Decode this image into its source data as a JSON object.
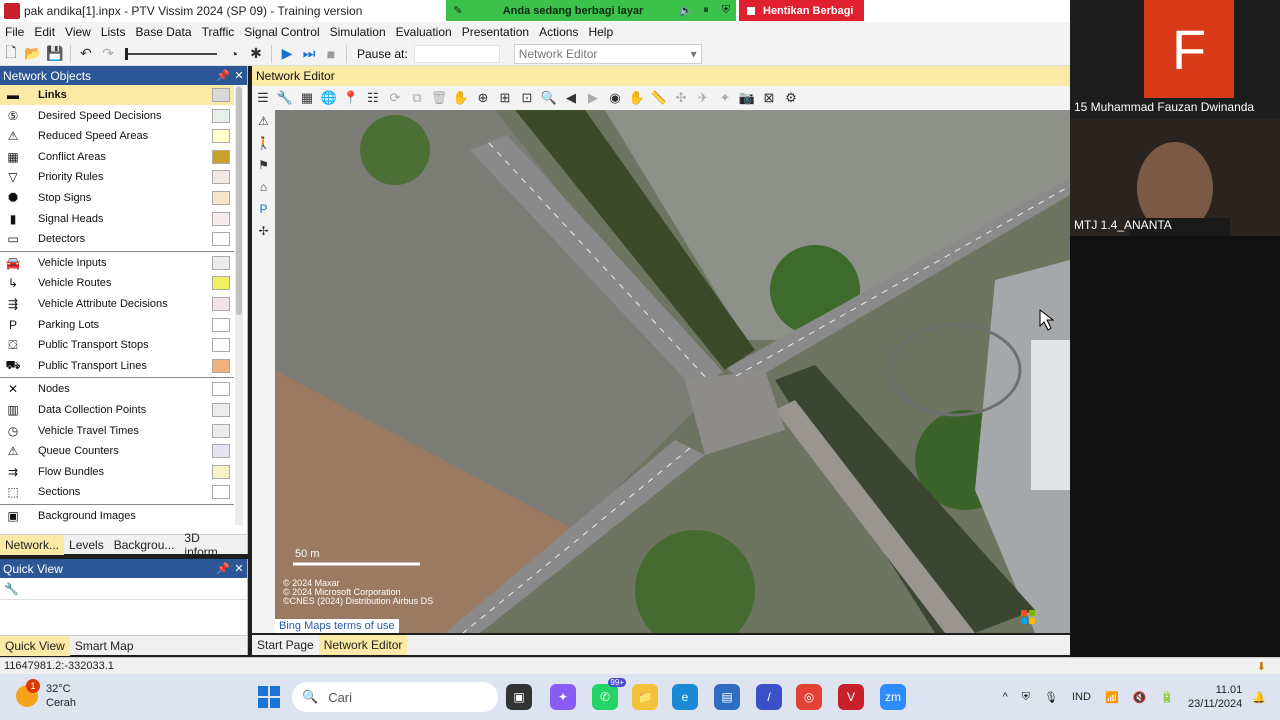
{
  "window": {
    "title": "pak andika[1].inpx - PTV Vissim 2024 (SP 09) - Training version"
  },
  "share_bar": {
    "message": "Anda sedang berbagi layar",
    "stop_label": "Hentikan Berbagi"
  },
  "menu": [
    "File",
    "Edit",
    "View",
    "Lists",
    "Base Data",
    "Traffic",
    "Signal Control",
    "Simulation",
    "Evaluation",
    "Presentation",
    "Actions",
    "Help"
  ],
  "toolbar": {
    "pause_label": "Pause at:",
    "pause_value": "",
    "view_select": "Network Editor"
  },
  "network_objects": {
    "title": "Network Objects",
    "items": [
      {
        "label": "Links",
        "icon": "links-icon",
        "swatch": "#d9d9d9",
        "selected": true
      },
      {
        "label": "Desired Speed Decisions",
        "icon": "speed-sign-icon",
        "swatch": "#e8efe8"
      },
      {
        "label": "Reduced Speed Areas",
        "icon": "warning-triangle-icon",
        "swatch": "#ffffcc"
      },
      {
        "label": "Conflict Areas",
        "icon": "conflict-icon",
        "swatch": "#c8a02a"
      },
      {
        "label": "Priority Rules",
        "icon": "yield-icon",
        "swatch": "#f2e9e4"
      },
      {
        "label": "Stop Signs",
        "icon": "stop-sign-icon",
        "swatch": "#f7e6cc"
      },
      {
        "label": "Signal Heads",
        "icon": "signal-head-icon",
        "swatch": "#f7ecec"
      },
      {
        "label": "Detectors",
        "icon": "detector-icon",
        "swatch": "#ffffff"
      },
      {
        "label": "Vehicle Inputs",
        "icon": "vehicle-input-icon",
        "swatch": "#ececec"
      },
      {
        "label": "Vehicle Routes",
        "icon": "vehicle-route-icon",
        "swatch": "#f0f060"
      },
      {
        "label": "Vehicle Attribute Decisions",
        "icon": "attribute-decision-icon",
        "swatch": "#f2e4e4"
      },
      {
        "label": "Parking Lots",
        "icon": "parking-icon",
        "swatch": "#ffffff"
      },
      {
        "label": "Public Transport Stops",
        "icon": "pt-stop-icon",
        "swatch": "#ffffff"
      },
      {
        "label": "Public Transport Lines",
        "icon": "pt-line-icon",
        "swatch": "#f0b27a"
      },
      {
        "label": "Nodes",
        "icon": "node-icon",
        "swatch": "#ffffff"
      },
      {
        "label": "Data Collection Points",
        "icon": "data-collection-icon",
        "swatch": "#ececec"
      },
      {
        "label": "Vehicle Travel Times",
        "icon": "travel-time-icon",
        "swatch": "#ececec"
      },
      {
        "label": "Queue Counters",
        "icon": "queue-counter-icon",
        "swatch": "#e4e4f2"
      },
      {
        "label": "Flow Bundles",
        "icon": "flow-bundle-icon",
        "swatch": "#f7f2cc"
      },
      {
        "label": "Sections",
        "icon": "section-icon",
        "swatch": "#ffffff"
      },
      {
        "label": "Background Images",
        "icon": "background-image-icon",
        "swatch": ""
      }
    ],
    "tabs": [
      "Network...",
      "Levels",
      "Backgrou...",
      "3D inform..."
    ]
  },
  "quick_view": {
    "title": "Quick View",
    "tabs": [
      "Quick View",
      "Smart Map"
    ]
  },
  "editor": {
    "title": "Network Editor",
    "tabs": [
      "Start Page",
      "Network Editor"
    ],
    "scale_label": "50 m",
    "credits": [
      "© 2024 Maxar",
      "© 2024 Microsoft Corporation",
      "©CNES (2024) Distribution Airbus DS"
    ],
    "terms": "Bing Maps terms of use"
  },
  "status": {
    "coords": "11647981.2:-332033.1"
  },
  "participants": [
    {
      "initial": "F",
      "name": "15 Muhammad Fauzan Dwinanda",
      "color": "#d93a1a"
    },
    {
      "name": "MTJ 1.4_ANANTA"
    }
  ],
  "taskbar": {
    "weather_temp": "32°C",
    "weather_desc": "Cerah",
    "weather_badge": "1",
    "search_placeholder": "Cari",
    "whatsapp_badge": "99+",
    "language": "IND",
    "time": "11.01",
    "date": "23/11/2024"
  }
}
